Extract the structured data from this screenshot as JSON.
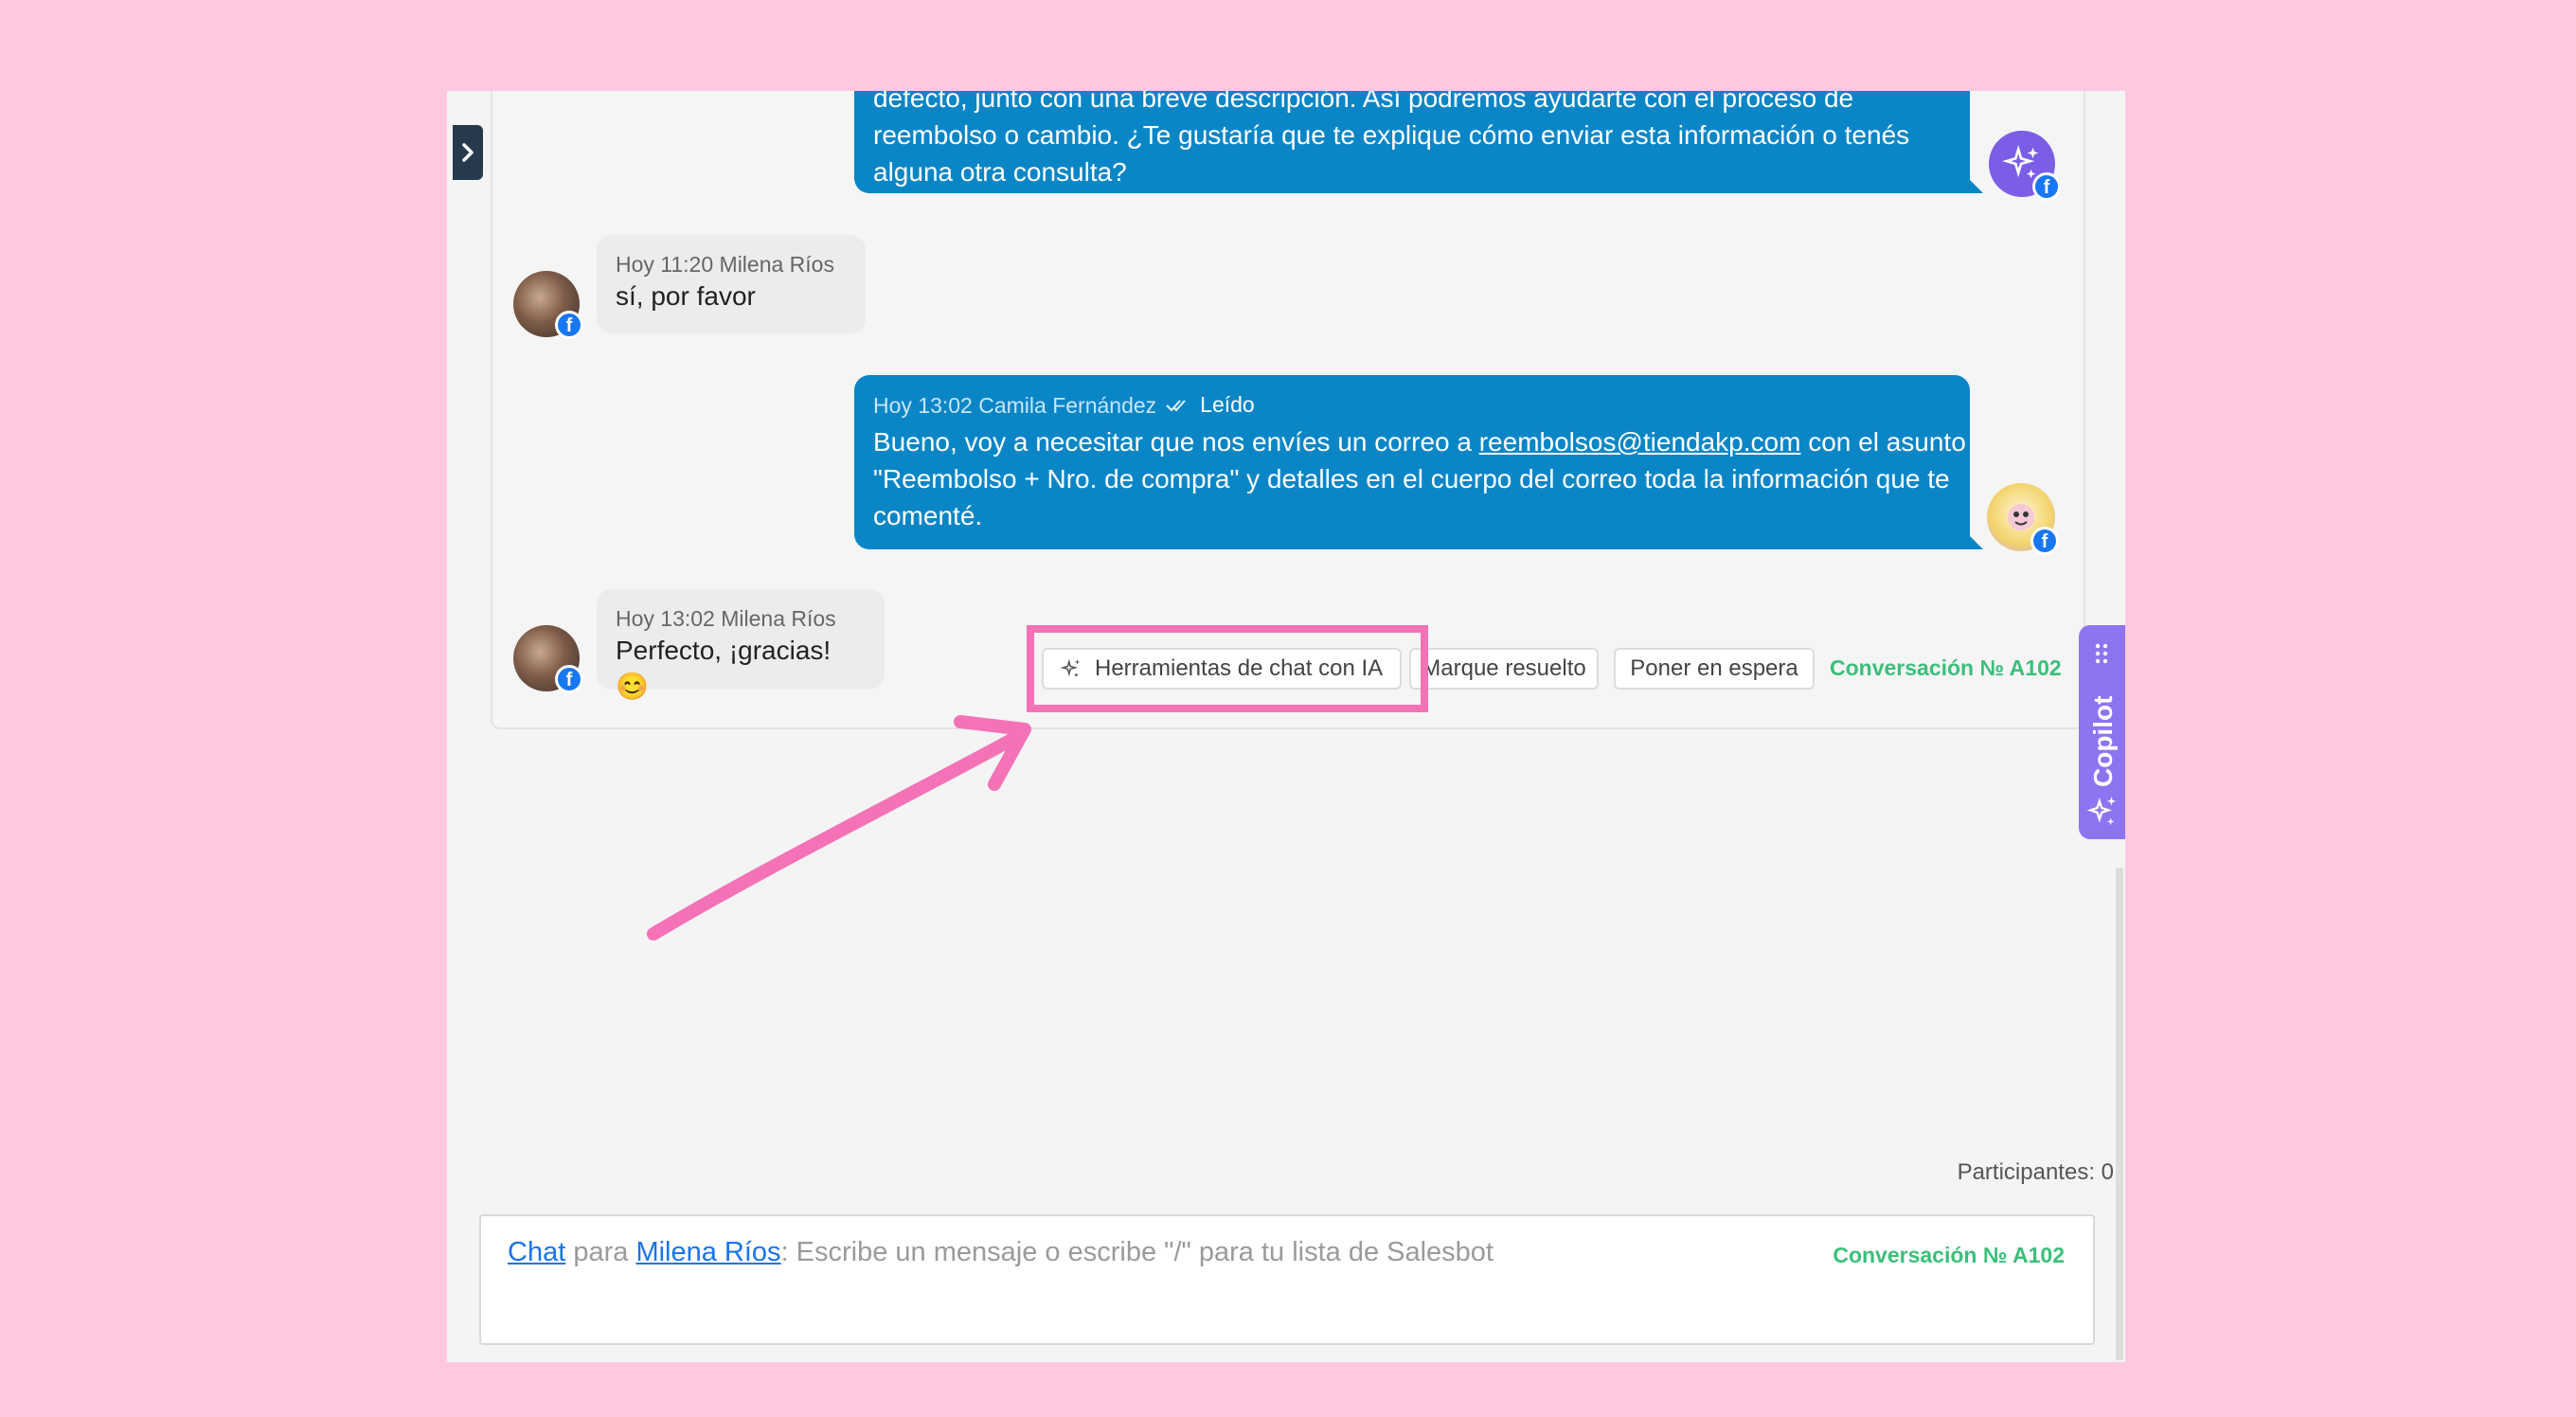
{
  "messages": [
    {
      "direction": "out",
      "text_line1": "defecto, junto con una breve descripción. Así podremos ayudarte con el proceso de",
      "text_line2": "reembolso o cambio. ¿Te gustaría que te explique cómo enviar esta información o tenés",
      "text_line3": "alguna otra consulta?"
    },
    {
      "direction": "in",
      "meta": "Hoy 11:20 Milena Ríos",
      "text": "sí, por favor"
    },
    {
      "direction": "out",
      "meta_time_author": "Hoy 13:02 Camila Fernández",
      "read_label": "Leído",
      "text_before_link": "Bueno, voy a necesitar que nos envíes un correo a ",
      "link": "reembolsos@tiendakp.com",
      "text_after_link": " con el asunto",
      "text_line2": "\"Reembolso + Nro. de compra\" y detalles en el cuerpo del correo toda la información que te",
      "text_line3": "comenté."
    },
    {
      "direction": "in",
      "meta": "Hoy 13:02 Milena Ríos",
      "text": "Perfecto, ¡gracias! 😊"
    }
  ],
  "actions": {
    "ai_tools": "Herramientas de chat con IA",
    "resolve": "Marque resuelto",
    "hold": "Poner en espera",
    "conversation_id": "Conversación № A102"
  },
  "copilot": {
    "label": "Copilot"
  },
  "participants": "Participantes: 0",
  "composer": {
    "channel": "Chat",
    "to_word": "para",
    "recipient": "Milena Ríos",
    "placeholder": ": Escribe un mensaje o escribe \"/\" para tu lista de Salesbot",
    "conversation_id": "Conversación № A102"
  },
  "colors": {
    "background": "#ffc8e0",
    "outgoing_bubble": "#0a86c6",
    "highlight": "#f472b6",
    "copilot": "#8d74f0",
    "conversation_tag": "#3bbf7a"
  },
  "icons": [
    "chevron-right-icon",
    "sparkle-icon",
    "facebook-icon",
    "drag-handle-icon",
    "double-check-icon"
  ]
}
